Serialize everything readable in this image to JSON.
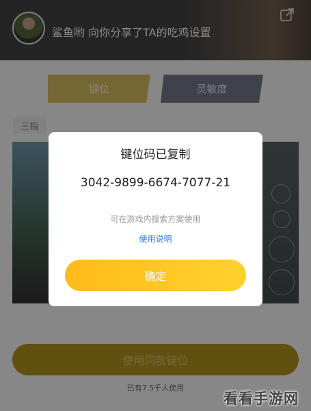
{
  "header": {
    "share_text": "鲨鱼哟 向你分享了TA的吃鸡设置",
    "share_icon": "external-share-icon"
  },
  "tabs": [
    {
      "label": "键位",
      "active": true
    },
    {
      "label": "灵敏度",
      "active": false
    }
  ],
  "finger_tag": "三指",
  "dialog": {
    "title": "键位码已复制",
    "code": "3042-9899-6674-7077-21",
    "hint": "可在游戏内搜索方案使用",
    "help_link": "使用说明",
    "confirm_label": "确定"
  },
  "use_button_label": "使用同款键位",
  "users_count_text": "已有7.5千人使用",
  "watermark": "看看手游网",
  "colors": {
    "accent": "#FFC21F",
    "link": "#2C7BE5",
    "tab_inactive": "#6F7282"
  }
}
